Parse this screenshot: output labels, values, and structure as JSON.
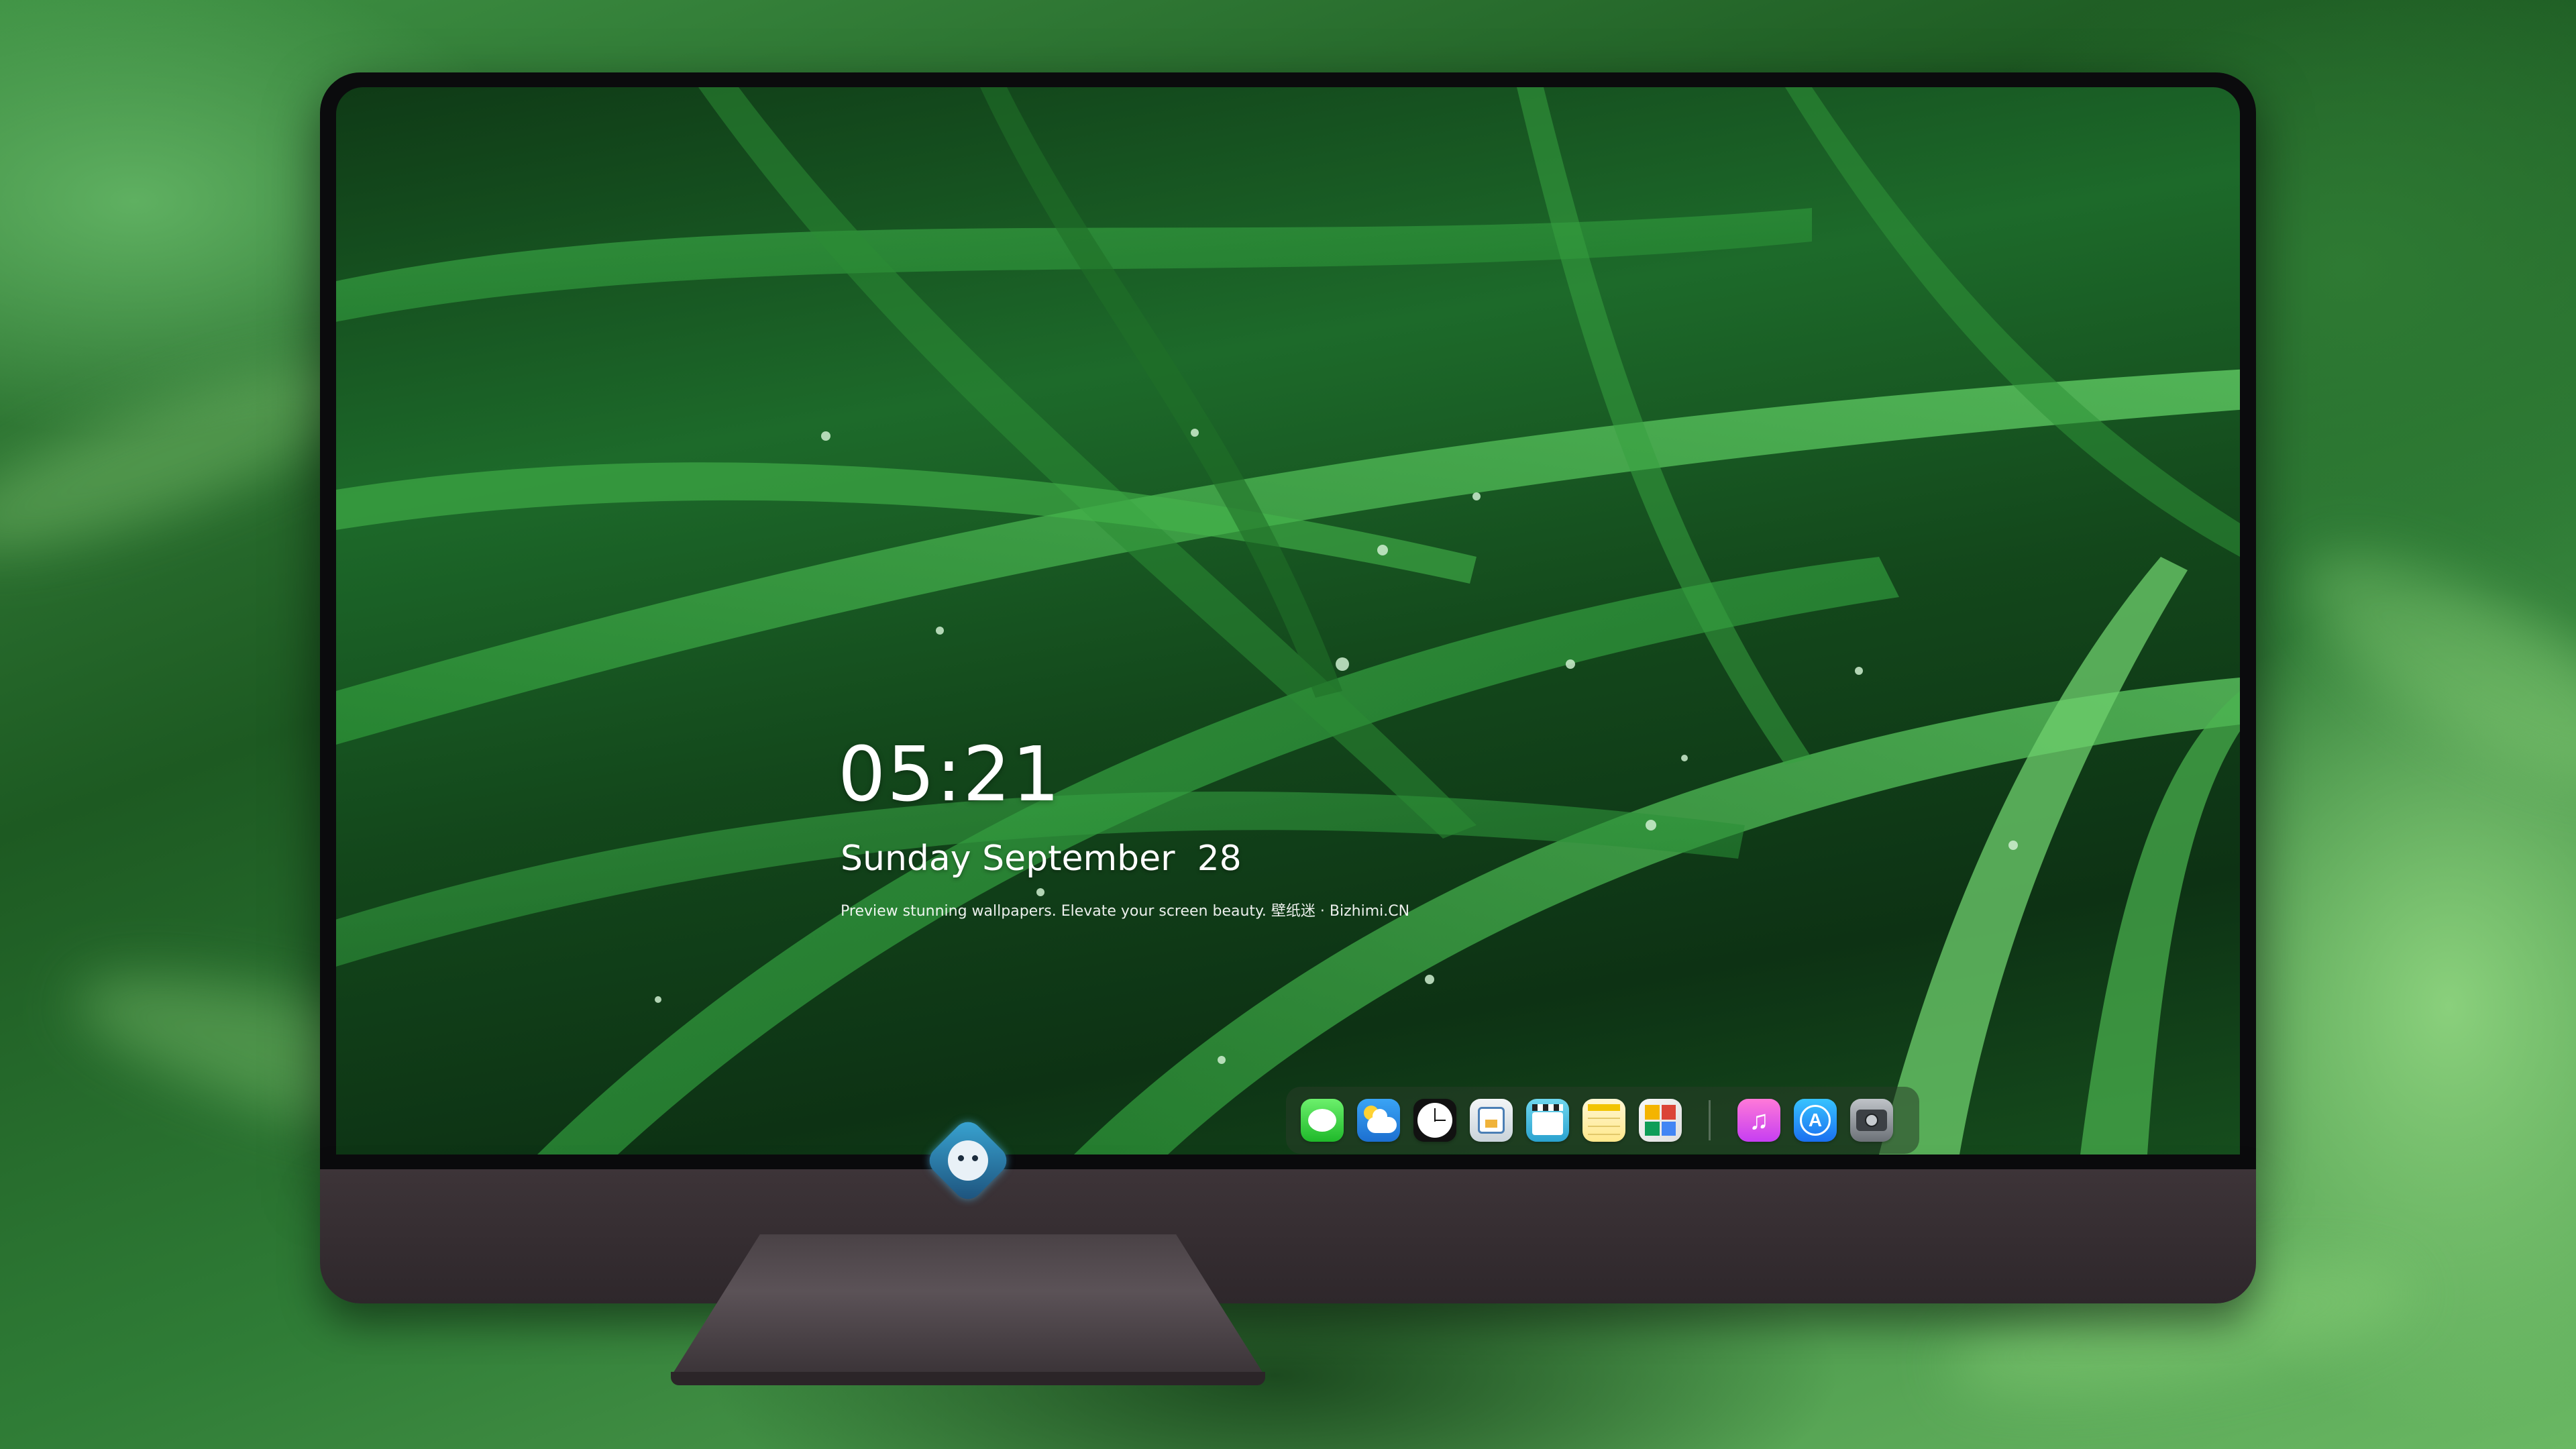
{
  "lock_screen": {
    "time": "05:21",
    "date": "Sunday September  28",
    "tagline": "Preview stunning wallpapers. Elevate your screen beauty. 壁纸迷 · Bizhimi.CN"
  },
  "dock": {
    "apps": [
      {
        "name": "Messages",
        "icon": "messages-icon"
      },
      {
        "name": "Weather",
        "icon": "weather-icon"
      },
      {
        "name": "Clock",
        "icon": "clock-icon"
      },
      {
        "name": "Preview",
        "icon": "preview-icon"
      },
      {
        "name": "Claquette",
        "icon": "clapperboard-icon"
      },
      {
        "name": "Notes",
        "icon": "notes-icon"
      },
      {
        "name": "Photos",
        "icon": "photos-icon"
      },
      {
        "name": "Music",
        "icon": "music-icon"
      },
      {
        "name": "App Store",
        "icon": "app-store-icon"
      },
      {
        "name": "Camera",
        "icon": "camera-icon"
      }
    ]
  },
  "colors": {
    "wallpaper_green": "#1d6a2a",
    "bezel": "#0b0b0d",
    "chin": "#3d3438",
    "stand": "#5b5257"
  }
}
